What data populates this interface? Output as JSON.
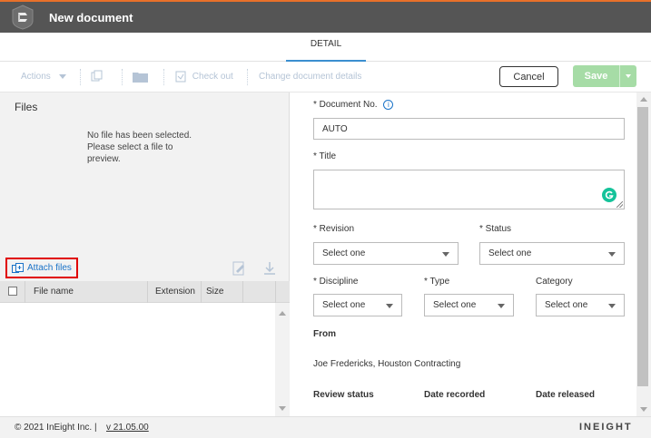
{
  "header": {
    "title": "New document",
    "logo": "ineight-logo-icon"
  },
  "tabs": [
    {
      "label": "DETAIL",
      "active": true
    }
  ],
  "toolbar": {
    "actions_label": "Actions",
    "checkout_label": "Check out",
    "change_details_label": "Change document details",
    "cancel_label": "Cancel",
    "save_label": "Save"
  },
  "files_panel": {
    "title": "Files",
    "empty_message": "No file has been selected. Please select a file to preview.",
    "attach_label": "Attach files",
    "columns": [
      "File name",
      "Extension",
      "Size"
    ]
  },
  "form": {
    "document_no": {
      "label": "* Document No.",
      "value": "AUTO"
    },
    "title": {
      "label": "* Title",
      "value": ""
    },
    "revision": {
      "label": "* Revision",
      "value": "Select one"
    },
    "status": {
      "label": "* Status",
      "value": "Select one"
    },
    "discipline": {
      "label": "* Discipline",
      "value": "Select one"
    },
    "type": {
      "label": "* Type",
      "value": "Select one"
    },
    "category": {
      "label": "Category",
      "value": "Select one"
    },
    "from": {
      "label": "From",
      "value": "Joe Fredericks, Houston Contracting"
    },
    "review_status_label": "Review status",
    "date_recorded_label": "Date recorded",
    "date_released_label": "Date released"
  },
  "footer": {
    "copyright": "© 2021 InEight Inc.  |",
    "version": "v 21.05.00",
    "brand": "INEIGHT"
  },
  "colors": {
    "accent": "#e8702a",
    "header": "#555555",
    "save": "#a6dca6",
    "link": "#1a73c8"
  }
}
